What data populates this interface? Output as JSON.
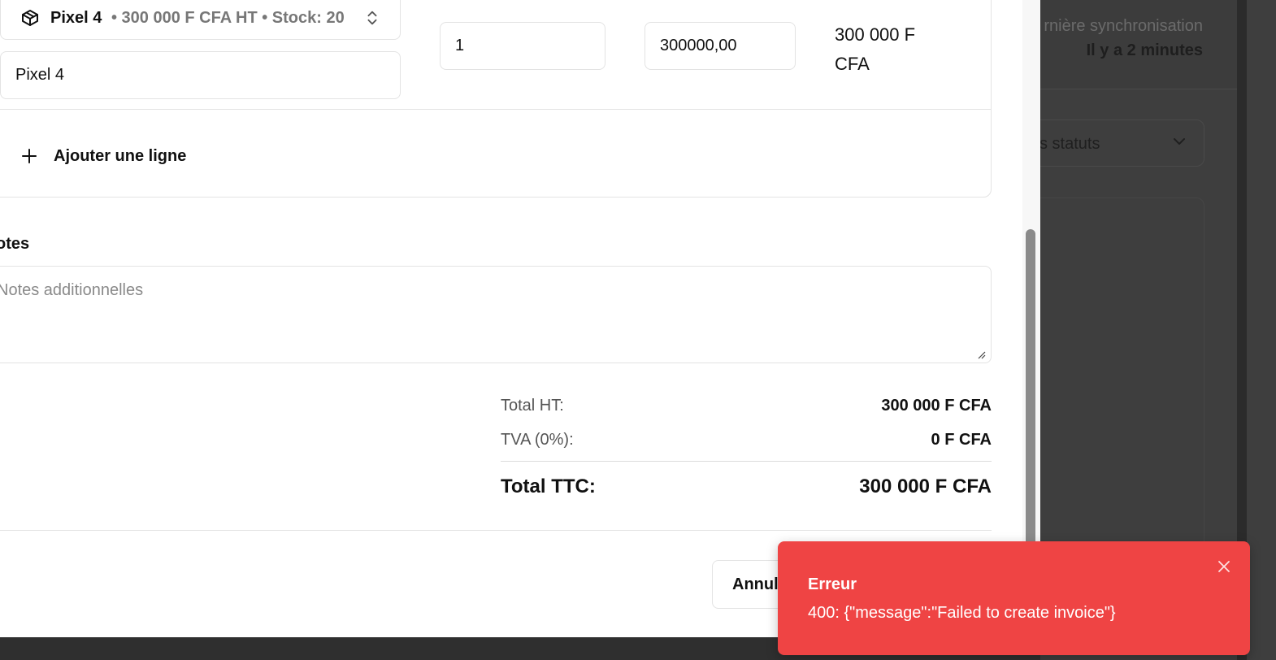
{
  "background": {
    "sync_label": "rnière synchronisation",
    "sync_value": "Il y a 2 minutes",
    "status_filter_label": "s statuts"
  },
  "line_item": {
    "product_name": "Pixel 4",
    "product_meta": "• 300 000 F CFA HT • Stock: 20",
    "description_value": "Pixel 4",
    "quantity_value": "1",
    "unit_price_value": "300000,00",
    "line_total": "300 000 F CFA"
  },
  "actions": {
    "add_line_label": "Ajouter une ligne",
    "cancel_label": "Annul"
  },
  "notes": {
    "label": "otes",
    "placeholder": "Notes additionnelles"
  },
  "totals": {
    "ht_label": "Total HT:",
    "ht_value": "300 000 F CFA",
    "tva_label": "TVA (0%):",
    "tva_value": "0 F CFA",
    "ttc_label": "Total TTC:",
    "ttc_value": "300 000 F CFA"
  },
  "toast": {
    "title": "Erreur",
    "message": "400: {\"message\":\"Failed to create invoice\"}"
  },
  "colors": {
    "toast_bg": "#ef4444",
    "overlay": "#3b3b3b"
  },
  "icons": [
    "package-icon",
    "chevron-up-down-icon",
    "plus-icon",
    "resize-handle-icon",
    "close-icon",
    "chevron-down-icon"
  ]
}
